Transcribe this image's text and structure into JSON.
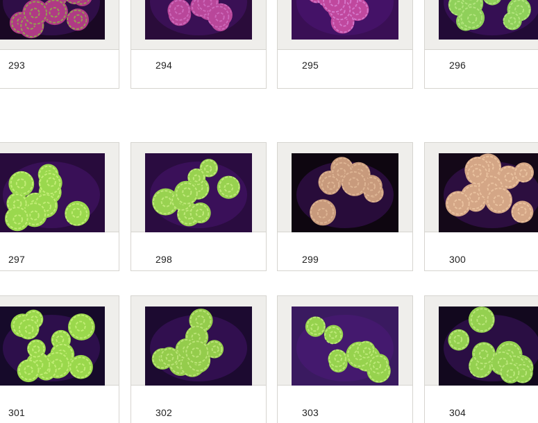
{
  "gallery": {
    "items": [
      {
        "label": "293",
        "coral_color": "#b03a85",
        "rim_color": "#8fb048",
        "bg_color": "#1a0824"
      },
      {
        "label": "294",
        "coral_color": "#b9479a",
        "rim_color": "#cf6fc0",
        "bg_color": "#2a0c3a"
      },
      {
        "label": "295",
        "coral_color": "#c0489e",
        "rim_color": "#d77fd0",
        "bg_color": "#3a0f55"
      },
      {
        "label": "296",
        "coral_color": "#8fd05a",
        "rim_color": "#b8e884",
        "bg_color": "#220a36"
      },
      {
        "label": "297",
        "coral_color": "#9ad84e",
        "rim_color": "#c8f07c",
        "bg_color": "#280b3c"
      },
      {
        "label": "298",
        "coral_color": "#98d250",
        "rim_color": "#c6ec80",
        "bg_color": "#2a0c40"
      },
      {
        "label": "299",
        "coral_color": "#c89a7c",
        "rim_color": "#e0b898",
        "bg_color": "#0e0610"
      },
      {
        "label": "300",
        "coral_color": "#d4a686",
        "rim_color": "#ecc6a2",
        "bg_color": "#140818"
      },
      {
        "label": "301",
        "coral_color": "#9ad84c",
        "rim_color": "#c6f07a",
        "bg_color": "#160a2a"
      },
      {
        "label": "302",
        "coral_color": "#94cc4c",
        "rim_color": "#bfe67c",
        "bg_color": "#1c0a30"
      },
      {
        "label": "303",
        "coral_color": "#96d24e",
        "rim_color": "#c2ec7e",
        "bg_color": "#3a1a60"
      },
      {
        "label": "304",
        "coral_color": "#94d050",
        "rim_color": "#c0ea80",
        "bg_color": "#12081e"
      }
    ]
  }
}
